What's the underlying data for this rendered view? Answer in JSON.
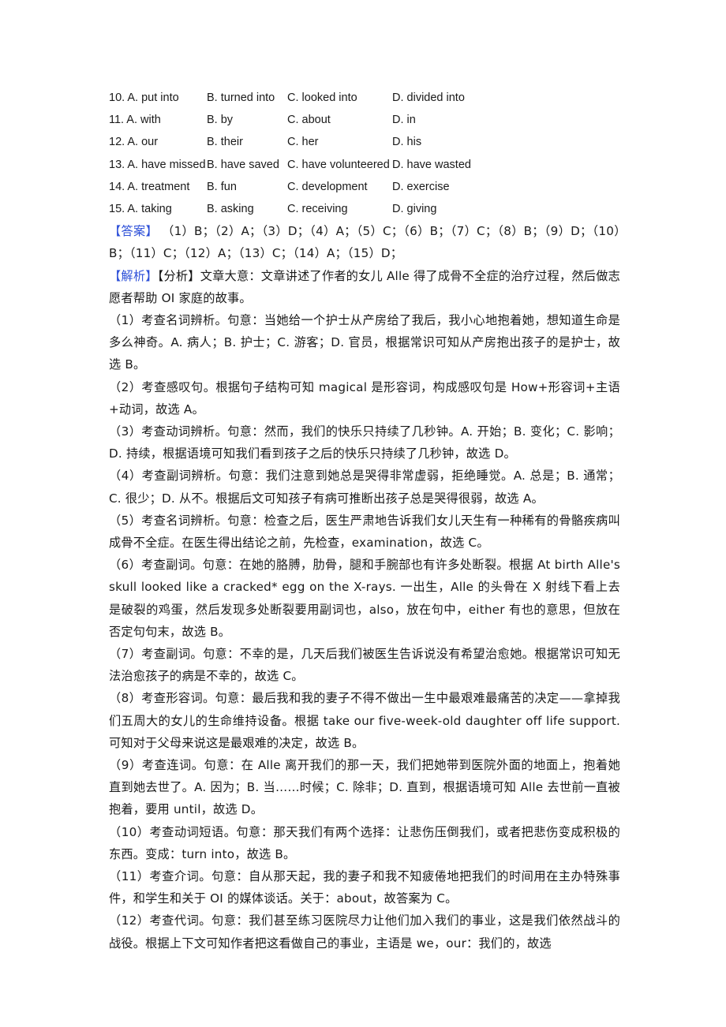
{
  "options": [
    {
      "num": "10.",
      "a": "A. put into",
      "b": "B. turned into",
      "c": "C. looked into",
      "d": "D. divided into"
    },
    {
      "num": "11.",
      "a": "A. with",
      "b": "B. by",
      "c": "C. about",
      "d": "D. in"
    },
    {
      "num": "12.",
      "a": "A. our",
      "b": "B. their",
      "c": "C. her",
      "d": "D. his"
    },
    {
      "num": "13.",
      "a": "A. have missed",
      "b": "B. have saved",
      "c": "C. have volunteered",
      "d": "D. have wasted"
    },
    {
      "num": "14.",
      "a": "A. treatment",
      "b": "B. fun",
      "c": "C. development",
      "d": "D. exercise"
    },
    {
      "num": "15.",
      "a": "A. taking",
      "b": "B. asking",
      "c": "C. receiving",
      "d": "D. giving"
    }
  ],
  "answer": {
    "label": "【答案】",
    "text": "（1）B；（2）A；（3）D；（4）A；（5）C；（6）B；（7）C；（8）B；（9）D；（10）B；（11）C；（12）A；（13）C；（14）A；（15）D；"
  },
  "analysis": {
    "label": "【解析】",
    "sublabel": "【分析】",
    "summary": "文章大意：文章讲述了作者的女儿 Alle 得了成骨不全症的治疗过程，然后做志愿者帮助 OI 家庭的故事。"
  },
  "explanations": [
    "（1）考查名词辨析。句意：当她给一个护士从产房给了我后，我小心地抱着她，想知道生命是多么神奇。A. 病人；B. 护士；C. 游客；D. 官员，根据常识可知从产房抱出孩子的是护士，故选 B。",
    "（2）考查感叹句。根据句子结构可知 magical 是形容词，构成感叹句是 How+形容词+主语+动词，故选 A。",
    "（3）考查动词辨析。句意：然而，我们的快乐只持续了几秒钟。A. 开始；B. 变化；C. 影响；D. 持续，根据语境可知我们看到孩子之后的快乐只持续了几秒钟，故选 D。",
    "（4）考查副词辨析。句意：我们注意到她总是哭得非常虚弱，拒绝睡觉。A. 总是；B. 通常；C. 很少；D. 从不。根据后文可知孩子有病可推断出孩子总是哭得很弱，故选 A。",
    "（5）考查名词辨析。句意：检查之后，医生严肃地告诉我们女儿天生有一种稀有的骨骼疾病叫成骨不全症。在医生得出结论之前，先检查，examination，故选 C。",
    "（6）考查副词。句意：在她的胳膊，肋骨，腿和手腕部也有许多处断裂。根据 At birth Alle's skull looked like a cracked* egg on the X-rays. 一出生，Alle 的头骨在 X 射线下看上去是破裂的鸡蛋，然后发现多处断裂要用副词也，also，放在句中，either 有也的意思，但放在否定句句末，故选 B。",
    "（7）考查副词。句意：不幸的是，几天后我们被医生告诉说没有希望治愈她。根据常识可知无法治愈孩子的病是不幸的，故选 C。",
    "（8）考查形容词。句意：最后我和我的妻子不得不做出一生中最艰难最痛苦的决定——拿掉我们五周大的女儿的生命维持设备。根据 take our five-week-old daughter off life support. 可知对于父母来说这是最艰难的决定，故选 B。",
    "（9）考查连词。句意：在 Alle 离开我们的那一天，我们把她带到医院外面的地面上，抱着她直到她去世了。A. 因为；B. 当……时候；C. 除非；D. 直到，根据语境可知 Alle 去世前一直被抱着，要用 until，故选 D。",
    "（10）考查动词短语。句意：那天我们有两个选择：让悲伤压倒我们，或者把悲伤变成积极的东西。变成：turn into，故选 B。",
    "（11）考查介词。句意：自从那天起，我的妻子和我不知疲倦地把我们的时间用在主办特殊事件，和学生和关于 OI 的媒体谈话。关于：about，故答案为 C。",
    "（12）考查代词。句意：我们甚至练习医院尽力让他们加入我们的事业，这是我们依然战斗的战役。根据上下文可知作者把这看做自己的事业，主语是 we，our：我们的，故选"
  ]
}
